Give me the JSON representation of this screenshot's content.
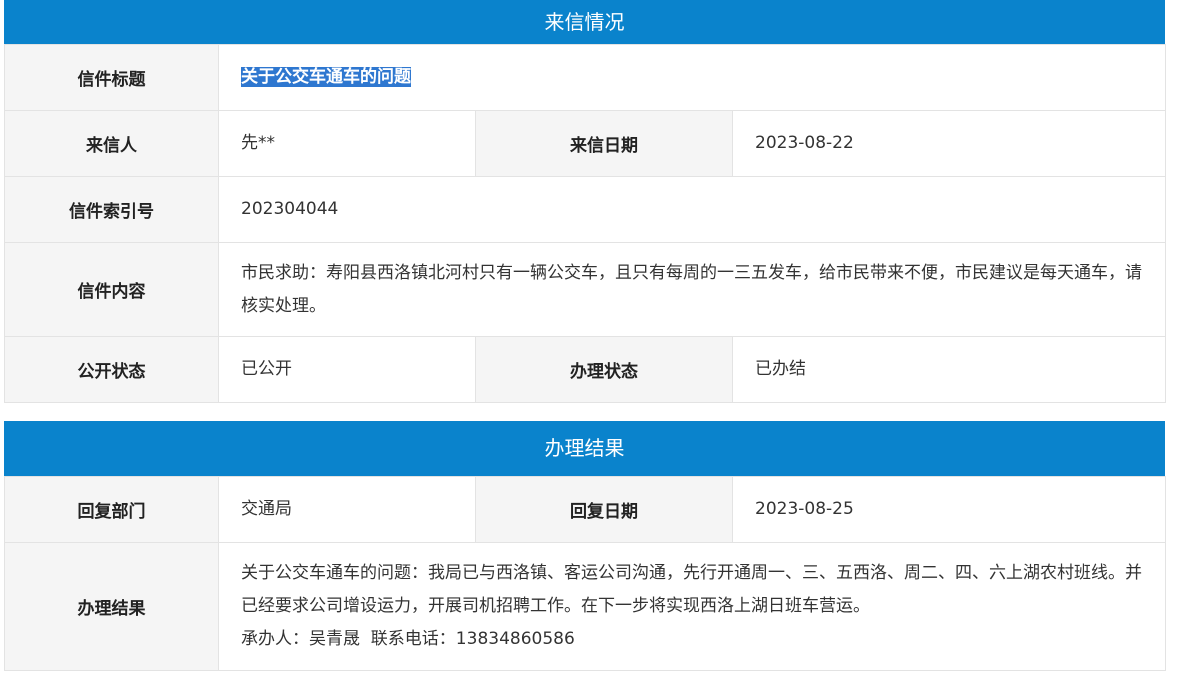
{
  "letter": {
    "section_title": "来信情况",
    "title_label": "信件标题",
    "title_value": "关于公交车通车的问题",
    "sender_label": "来信人",
    "sender_value": "先**",
    "date_label": "来信日期",
    "date_value": "2023-08-22",
    "index_label": "信件索引号",
    "index_value": "202304044",
    "content_label": "信件内容",
    "content_value": "市民求助：寿阳县西洛镇北河村只有一辆公交车，且只有每周的一三五发车，给市民带来不便，市民建议是每天通车，请核实处理。",
    "public_label": "公开状态",
    "public_value": "已公开",
    "status_label": "办理状态",
    "status_value": "已办结"
  },
  "result": {
    "section_title": "办理结果",
    "dept_label": "回复部门",
    "dept_value": "交通局",
    "reply_date_label": "回复日期",
    "reply_date_value": "2023-08-25",
    "result_label": "办理结果",
    "result_value": "关于公交车通车的问题：我局已与西洛镇、客运公司沟通，先行开通周一、三、五西洛、周二、四、六上湖农村班线。并已经要求公司增设运力，开展司机招聘工作。在下一步将实现西洛上湖日班车营运。",
    "handler_line": "承办人：吴青晟  联系电话：13834860586"
  },
  "colors": {
    "header_bg": "#0a83cc",
    "label_bg": "#f5f5f5",
    "border": "#e3e3e3",
    "highlight": "#2e77d0"
  }
}
